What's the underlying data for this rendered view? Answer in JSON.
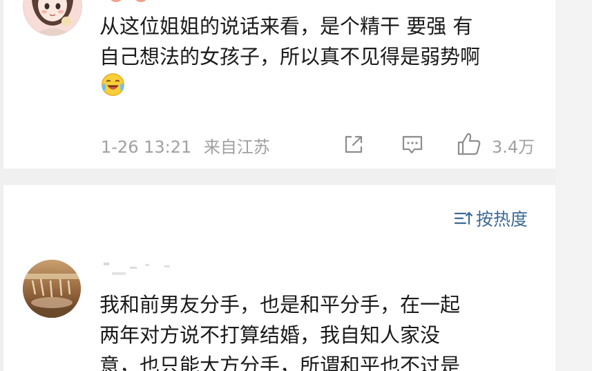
{
  "comments": [
    {
      "text_lines": [
        "从这位姐姐的说话来看，是个精干 要强 有",
        "自己想法的女孩子，所以真不见得是弱势啊"
      ],
      "emoji": "laugh-cry-emoji",
      "timestamp": "1-26 13:21",
      "source": "来自江苏",
      "like_count": "3.4万",
      "icons": {
        "share": "share-icon",
        "reply": "comment-icon",
        "like": "thumbs-up-icon"
      }
    },
    {
      "text_lines": [
        "我和前男友分手，也是和平分手，在一起",
        "两年对方说不打算结婚，我自知人家没",
        "意，也只能大方分手，所谓和平也不过是"
      ]
    }
  ],
  "sort": {
    "label": "按热度",
    "icon": "sort-icon"
  },
  "colors": {
    "text": "#1a1a1a",
    "meta": "#a0a0a0",
    "link": "#3c6a97",
    "background": "#f0f0f0",
    "card": "#ffffff"
  }
}
